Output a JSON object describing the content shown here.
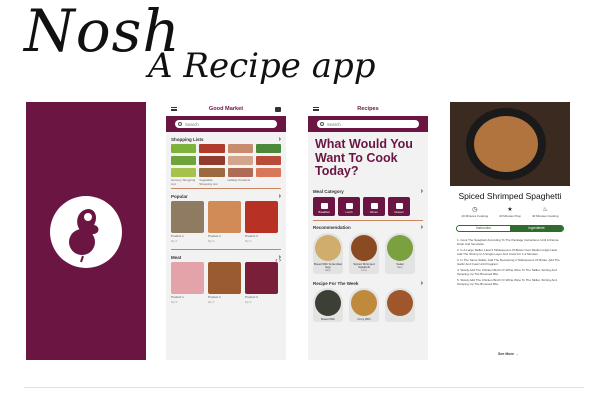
{
  "branding": {
    "title": "Nosh",
    "tagline": "A Recipe app"
  },
  "market": {
    "title": "Good Market",
    "search_placeholder": "Search",
    "shopping_heading": "Shopping Lists",
    "shopping_items": [
      {
        "label": "Grocery Shopping List",
        "color": "#7db33a"
      },
      {
        "label": "Vegetable Shopping List",
        "color": "#b23a2a"
      },
      {
        "label": "Holiday Products",
        "color": "#c98b6e"
      },
      {
        "label": "",
        "color": "#4c8a3a"
      }
    ],
    "popular_heading": "Popular",
    "popular_items": [
      {
        "name": "Product 1",
        "price": "Rp 0",
        "color": "#8f7b62"
      },
      {
        "name": "Product 2",
        "price": "Rp 0",
        "color": "#d08b56"
      },
      {
        "name": "Product 3",
        "price": "Rp 0",
        "color": "#b83125"
      }
    ],
    "meat_heading": "Meat",
    "meat_items": [
      {
        "name": "Product 1",
        "price": "Rp 0",
        "color": "#e3a3a8"
      },
      {
        "name": "Product 2",
        "price": "Rp 0",
        "color": "#9b5b30"
      },
      {
        "name": "Product 3",
        "price": "Rp 0",
        "color": "#7a1f3a"
      }
    ]
  },
  "recipes": {
    "title": "Recipes",
    "search_placeholder": "Search",
    "headline": "What Would You Want To Cook Today?",
    "category_heading": "Meal Category",
    "categories": [
      "Breakfast",
      "Lunch",
      "Dinner",
      "Dessert"
    ],
    "recommendation_heading": "Recommendation",
    "recommendations": [
      {
        "name": "Bread With Scrambled Egg",
        "meta": "Easy",
        "color": "#cfae6d"
      },
      {
        "name": "Spiced Shrimped Spaghetti",
        "meta": "Level",
        "color": "#8a4a22"
      },
      {
        "name": "Salad",
        "meta": "Easy",
        "color": "#7aa03f"
      }
    ],
    "week_heading": "Recipe For The Week",
    "week_items": [
      {
        "name": "Bread With",
        "color": "#3b3f36"
      },
      {
        "name": "Curry With",
        "color": "#c08a3c"
      },
      {
        "name": "",
        "color": "#a0562b"
      }
    ]
  },
  "detail": {
    "title": "Spiced Shrimped Spaghetti",
    "stats": [
      {
        "icon": "clock-icon",
        "glyph": "◷",
        "label": "40 Minutes Cooking"
      },
      {
        "icon": "star-icon",
        "glyph": "★",
        "label": "40 Minutes Prep"
      },
      {
        "icon": "flame-icon",
        "glyph": "♨",
        "label": "40 Minutes Cooking"
      }
    ],
    "toggle": [
      "Instruction",
      "Ingredients"
    ],
    "steps": [
      "1. Cook The Spaghetti According To The Package Instructions Until Al Dente. Drain And Set Aside.",
      "2. In A Large Skillet, Heat 2 Tablespoons Of Butter Over Medium-High Heat. Add The Shrimp In A Single Layer And Cook For 1-2 Minutes.",
      "3. In The Same Skillet, Add The Remaining 2 Tablespoons Of Butter. Add The Garlic And Cook Until Fragrant.",
      "4. Slowly Add The Chicken Broth Or White Wine To The Skillet, Stirring And Scraping Up The Browned Bits.",
      "5. Slowly Add The Chicken Broth Or White Wine To The Skillet, Stirring And Scraping Up The Browned Bits."
    ],
    "see_more": "See More"
  },
  "colors": {
    "brand": "#6b1543",
    "accent": "#c9855f",
    "green": "#2f6b2c"
  }
}
